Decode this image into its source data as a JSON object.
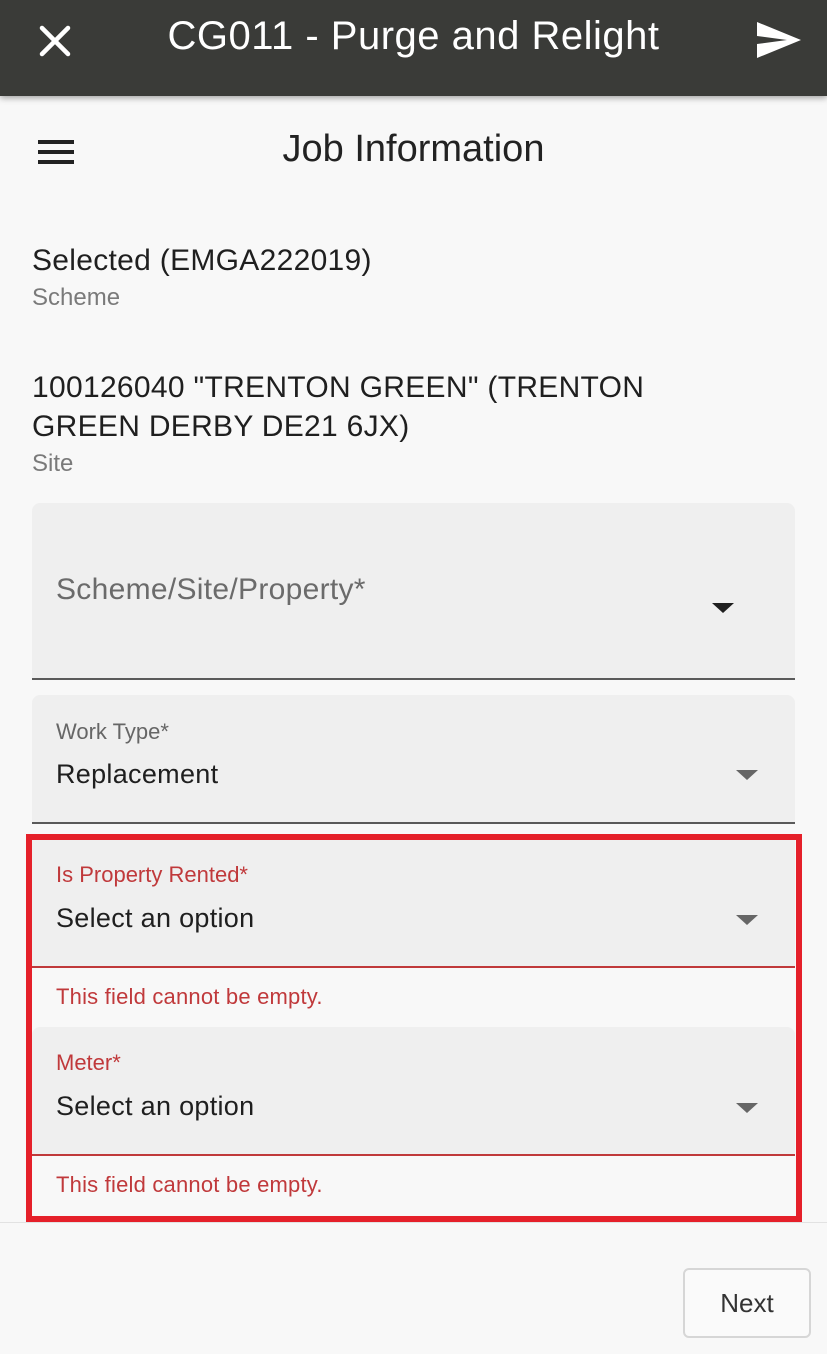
{
  "app_bar": {
    "title": "CG011 - Purge and Relight",
    "close_icon": "close-icon",
    "send_icon": "send-icon",
    "background_color": "#3a3b38"
  },
  "header": {
    "menu_icon": "hamburger-menu-icon",
    "title": "Job Information"
  },
  "scheme": {
    "value": "Selected (EMGA222019)",
    "label": "Scheme"
  },
  "site": {
    "value_line1": "100126040 \"TRENTON GREEN\" (TRENTON",
    "value_line2": "GREEN DERBY DE21 6JX)",
    "label": "Site"
  },
  "fields": {
    "scheme_site_property": {
      "placeholder": "Scheme/Site/Property*"
    },
    "work_type": {
      "label": "Work Type*",
      "value": "Replacement"
    },
    "is_property_rented": {
      "label": "Is Property Rented*",
      "value": "Select an option",
      "error": "This field cannot be empty."
    },
    "meter": {
      "label": "Meter*",
      "value": "Select an option",
      "error": "This field cannot be empty."
    }
  },
  "footer": {
    "next_label": "Next"
  },
  "colors": {
    "error": "#c0393b",
    "highlight_border": "#e5202a"
  }
}
